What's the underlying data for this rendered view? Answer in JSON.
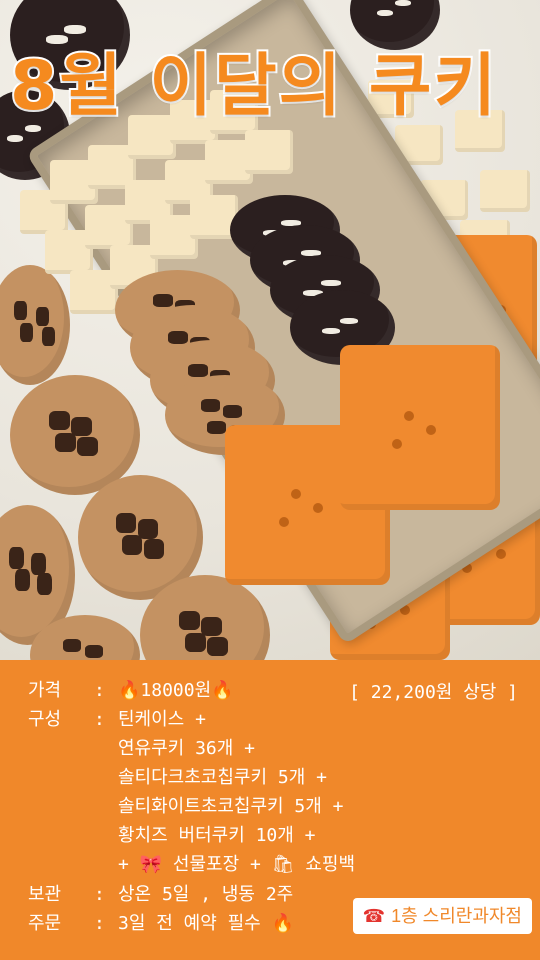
{
  "title": "8월 이달의 쿠키",
  "price": {
    "label": "가격",
    "sep": ":",
    "value": "18000원",
    "compare": "[ 22,200원 상당 ]"
  },
  "composition": {
    "label": "구성",
    "sep": ":",
    "items": [
      "틴케이스 +",
      "연유쿠키 36개 +",
      "솔티다크초코칩쿠키 5개 +",
      "솔티화이트초코칩쿠키 5개 +",
      "황치즈 버터쿠키 10개 +",
      "+ 🎀 선물포장 + 🛍 쇼핑백"
    ]
  },
  "storage": {
    "label": "보관",
    "sep": ":",
    "value": "상온 5일 , 냉동 2주"
  },
  "order": {
    "label": "주문",
    "sep": ":",
    "value": "3일 전 예약 필수"
  },
  "store": {
    "icon": "phone-icon",
    "name": "1층 스리란과자점"
  },
  "colors": {
    "accent": "#f0882a",
    "title": "#f58a1f"
  }
}
